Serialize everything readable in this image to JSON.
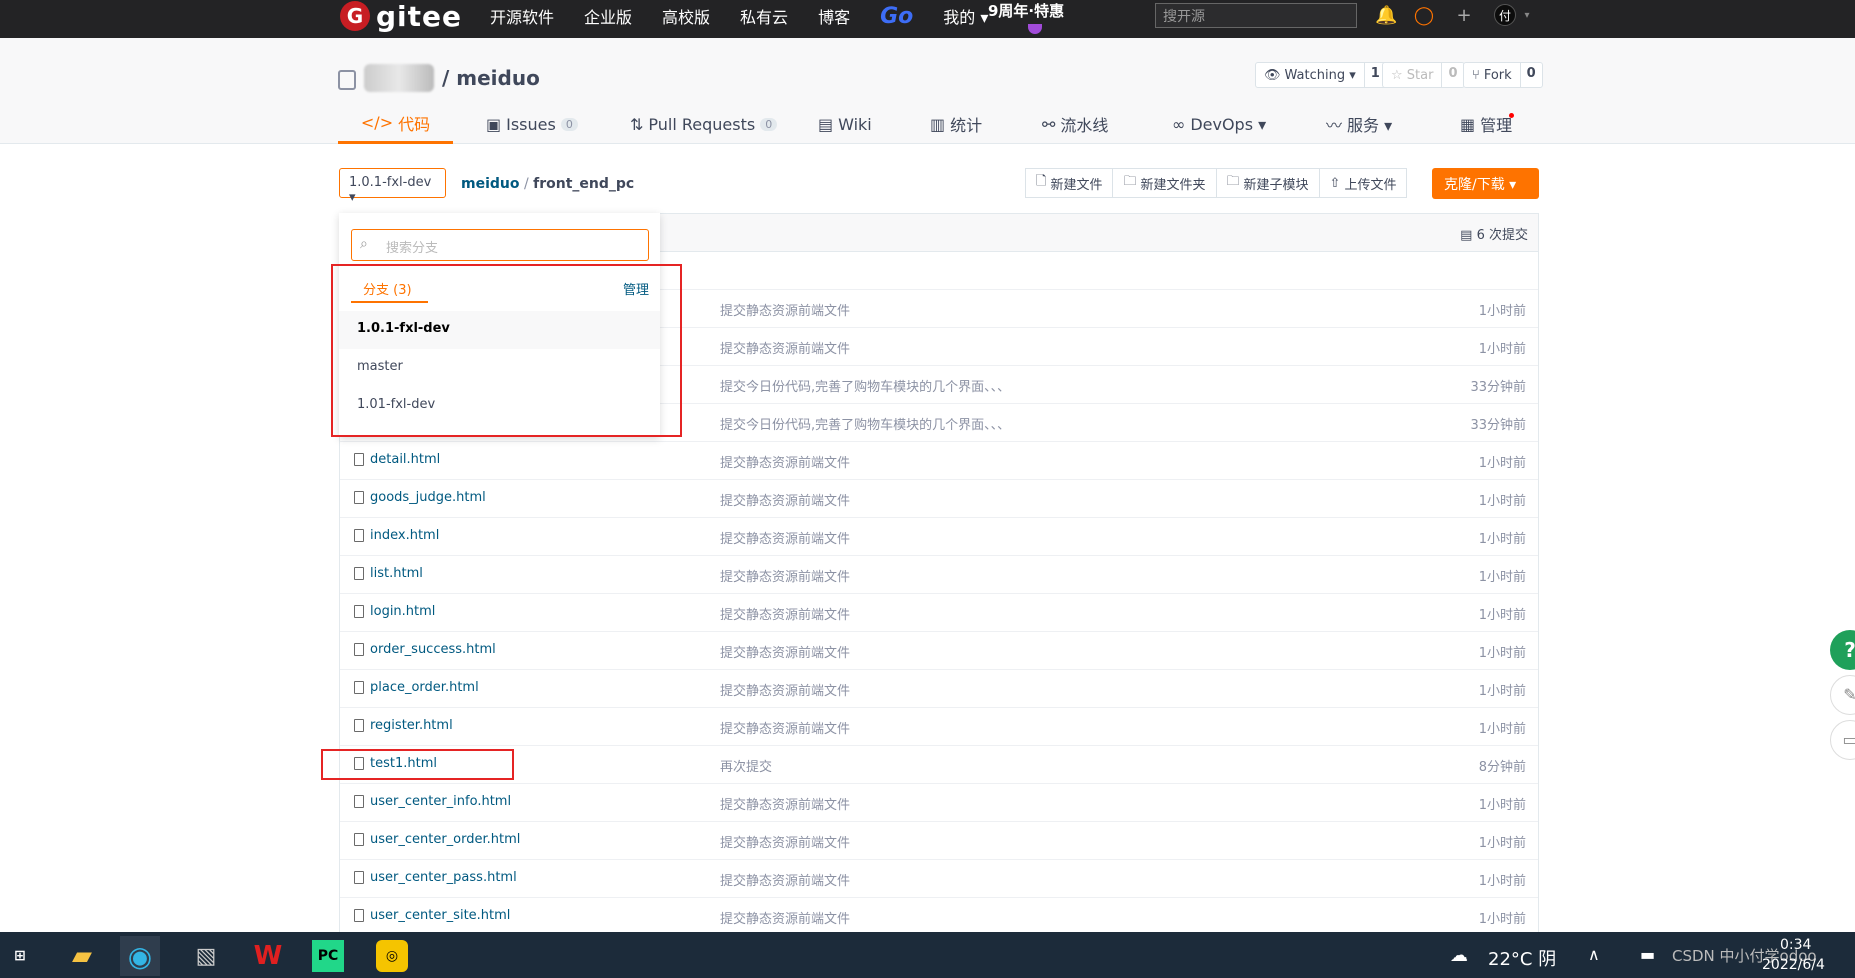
{
  "topbar": {
    "logo_letter": "G",
    "logo_text": "gitee",
    "nav": [
      "开源软件",
      "企业版",
      "高校版",
      "私有云",
      "博客",
      "Go",
      "我的 ▾"
    ],
    "promo": "9周年·特惠",
    "search_placeholder": "搜开源",
    "avatar": "付"
  },
  "repo": {
    "name": "/ meiduo",
    "watching_label": "Watching ▾",
    "watching_count": "1",
    "star_label": "☆ Star",
    "star_count": "0",
    "fork_label": "Fork",
    "fork_count": "0"
  },
  "tabs": {
    "code": "代码",
    "issues": "Issues",
    "issues_count": "0",
    "pulls": "Pull Requests",
    "pulls_count": "0",
    "wiki": "Wiki",
    "stats": "统计",
    "pipeline": "流水线",
    "devops": "DevOps ▾",
    "service": "服务 ▾",
    "manage": "管理"
  },
  "toolbar": {
    "branch": "1.0.1-fxl-dev ▾",
    "crumb_repo": "meiduo",
    "crumb_sep": " / ",
    "crumb_dir": "front_end_pc",
    "new_file": "新建文件",
    "new_folder": "新建文件夹",
    "new_submodule": "新建子模块",
    "upload": "上传文件",
    "clone": "克隆/下载 ▾"
  },
  "commit_count": "6 次提交",
  "dropdown": {
    "search_placeholder": "搜索分支",
    "tab": "分支 (3)",
    "manage": "管理",
    "branches": [
      "1.0.1-fxl-dev",
      "master",
      "1.01-fxl-dev"
    ]
  },
  "rows_hidden": [
    {
      "msg": "提交静态资源前端文件",
      "time": "1小时前"
    },
    {
      "msg": "提交静态资源前端文件",
      "time": "1小时前"
    },
    {
      "msg": "提交今日份代码,完善了购物车模块的几个界面、、、",
      "time": "33分钟前"
    },
    {
      "msg": "提交今日份代码,完善了购物车模块的几个界面、、、",
      "time": "33分钟前"
    }
  ],
  "files": [
    {
      "name": "detail.html",
      "msg": "提交静态资源前端文件",
      "time": "1小时前"
    },
    {
      "name": "goods_judge.html",
      "msg": "提交静态资源前端文件",
      "time": "1小时前"
    },
    {
      "name": "index.html",
      "msg": "提交静态资源前端文件",
      "time": "1小时前"
    },
    {
      "name": "list.html",
      "msg": "提交静态资源前端文件",
      "time": "1小时前"
    },
    {
      "name": "login.html",
      "msg": "提交静态资源前端文件",
      "time": "1小时前"
    },
    {
      "name": "order_success.html",
      "msg": "提交静态资源前端文件",
      "time": "1小时前"
    },
    {
      "name": "place_order.html",
      "msg": "提交静态资源前端文件",
      "time": "1小时前"
    },
    {
      "name": "register.html",
      "msg": "提交静态资源前端文件",
      "time": "1小时前"
    },
    {
      "name": "test1.html",
      "msg": "再次提交",
      "time": "8分钟前"
    },
    {
      "name": "user_center_info.html",
      "msg": "提交静态资源前端文件",
      "time": "1小时前"
    },
    {
      "name": "user_center_order.html",
      "msg": "提交静态资源前端文件",
      "time": "1小时前"
    },
    {
      "name": "user_center_pass.html",
      "msg": "提交静态资源前端文件",
      "time": "1小时前"
    },
    {
      "name": "user_center_site.html",
      "msg": "提交静态资源前端文件",
      "time": "1小时前"
    }
  ],
  "taskbar": {
    "weather": "22°C 阴",
    "time": "0:34",
    "date": "2022/6/4",
    "tray_text": "CSDN 中小付学odoo"
  },
  "colors": {
    "accent": "#fe7300",
    "link": "#005980",
    "highlight": "#e52424"
  }
}
